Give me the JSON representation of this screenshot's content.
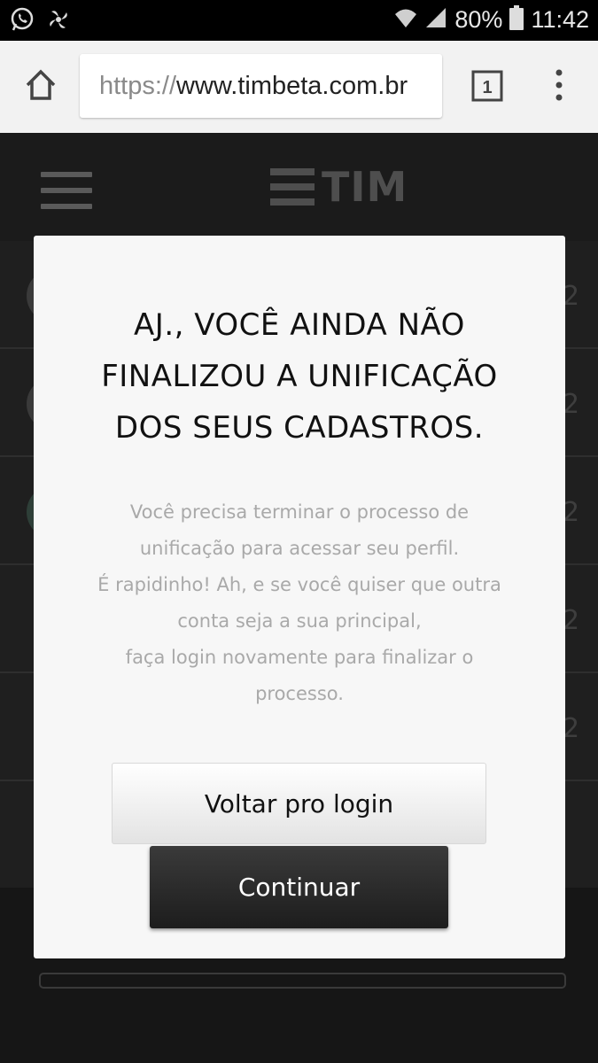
{
  "status_bar": {
    "battery": "80%",
    "time": "11:42",
    "icons": [
      "whatsapp-icon",
      "pinwheel-icon",
      "wifi-icon",
      "cellular-signal-icon",
      "battery-icon"
    ]
  },
  "browser": {
    "url_scheme": "https://",
    "url_host": "www.timbeta.com.br",
    "tab_count": "1"
  },
  "page": {
    "logo_text": "TIM",
    "row_edge_glyph": "2"
  },
  "modal": {
    "title": "AJ., VOCÊ AINDA NÃO\nFINALIZOU A UNIFICAÇÃO\nDOS SEUS CADASTROS.",
    "description_lines": [
      "Você precisa terminar o processo de",
      "unificação para acessar seu perfil.",
      "É rapidinho! Ah, e se você quiser que outra",
      "conta seja a sua principal,",
      "faça login novamente para finalizar o",
      "processo."
    ],
    "back_button_label": "Voltar pro login",
    "continue_button_label": "Continuar"
  },
  "colors": {
    "modal_background": "#f7f7f7",
    "primary_button": "#262626",
    "description_text": "#a9a9a9"
  }
}
